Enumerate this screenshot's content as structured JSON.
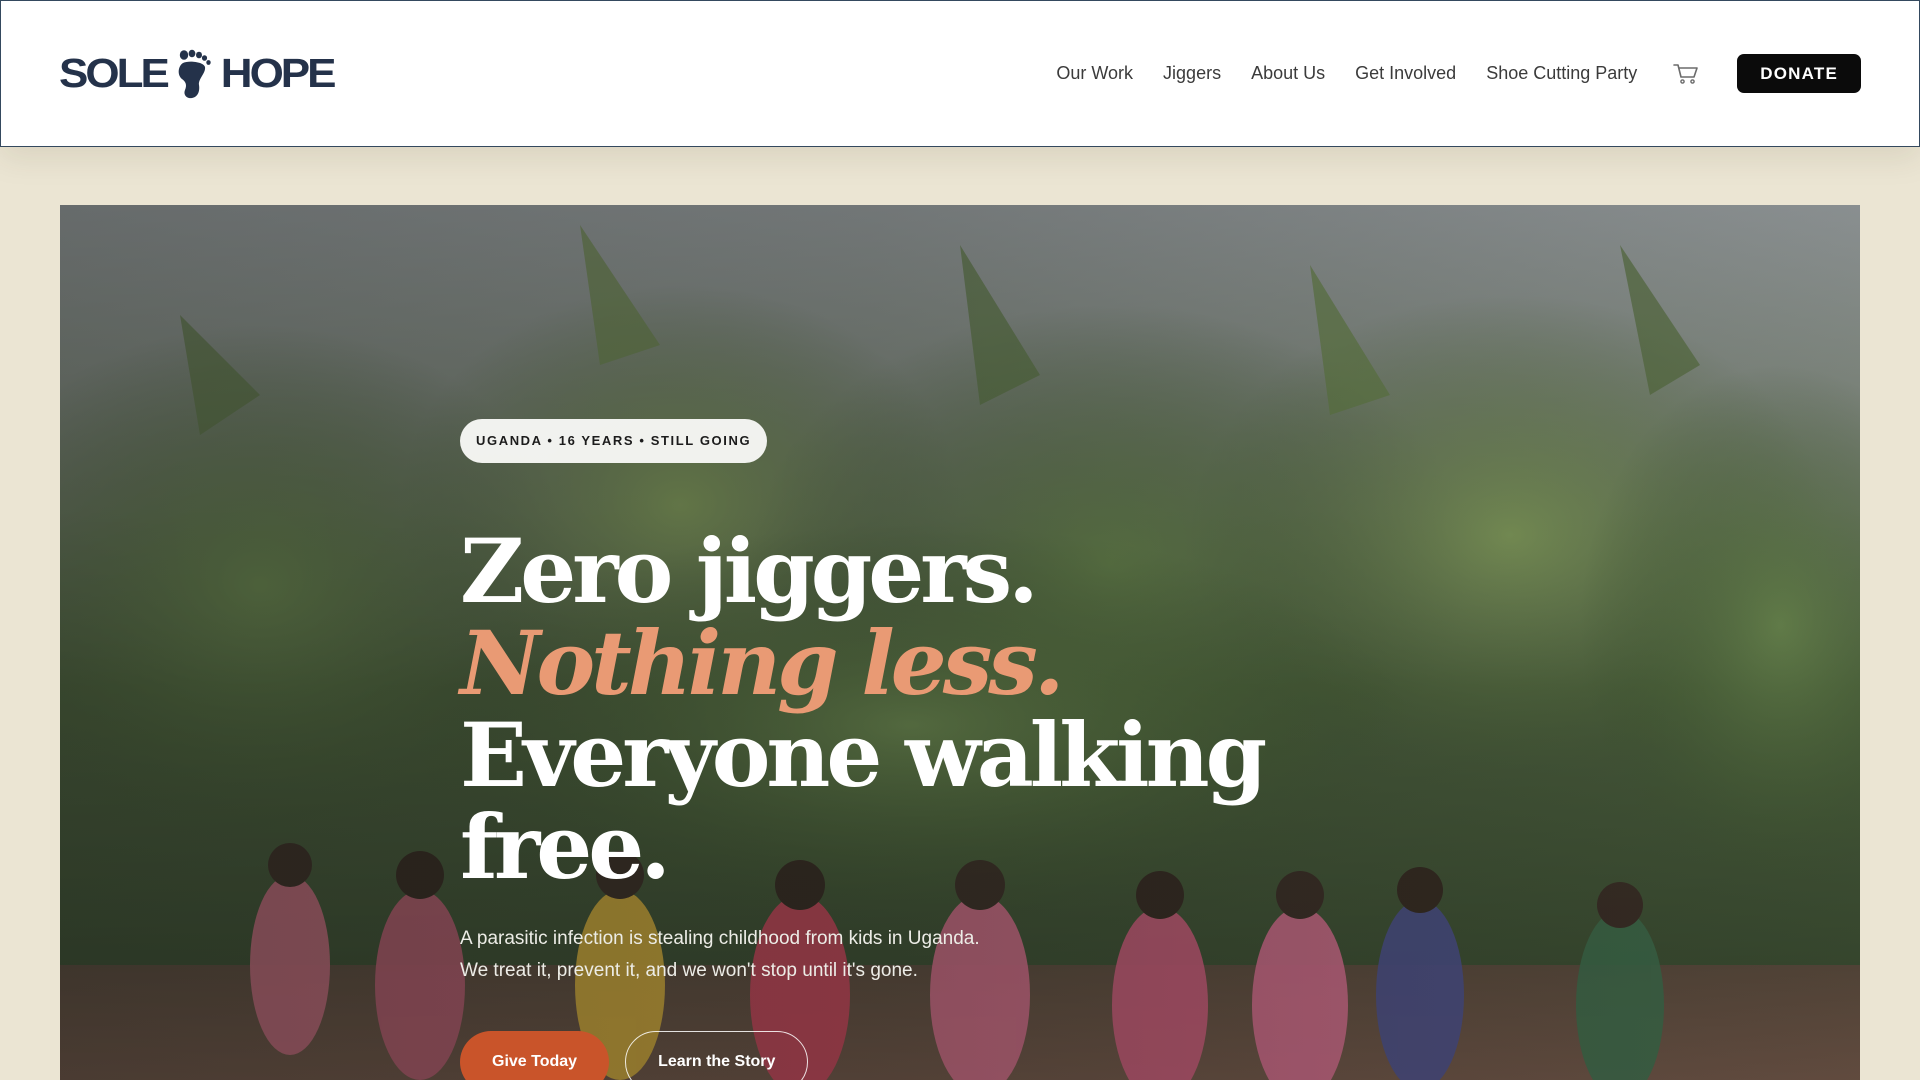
{
  "header": {
    "logo_text_left": "SOLE",
    "logo_text_right": "HOPE",
    "logo_icon": "footprint-icon",
    "nav": [
      {
        "label": "Our Work"
      },
      {
        "label": "Jiggers"
      },
      {
        "label": "About Us"
      },
      {
        "label": "Get Involved"
      },
      {
        "label": "Shoe Cutting Party"
      }
    ],
    "cart_icon": "cart-icon",
    "donate_label": "DONATE"
  },
  "hero": {
    "eyebrow": "UGANDA • 16 YEARS • STILL GOING",
    "headline_line1": "Zero jiggers.",
    "headline_line2": "Nothing less.",
    "headline_line3": "Everyone walking",
    "headline_line4": "free.",
    "subtext_line1": "A parasitic infection is stealing childhood from kids in Uganda.",
    "subtext_line2": "We treat it, prevent it, and we won't stop until it's gone.",
    "primary_cta": "Give Today",
    "secondary_cta": "Learn the Story"
  },
  "colors": {
    "page_background": "#ebe5d3",
    "accent": "#e99a74",
    "primary_button": "#c9542a",
    "donate_button": "#0b0b0b",
    "brand_navy": "#24324a"
  }
}
